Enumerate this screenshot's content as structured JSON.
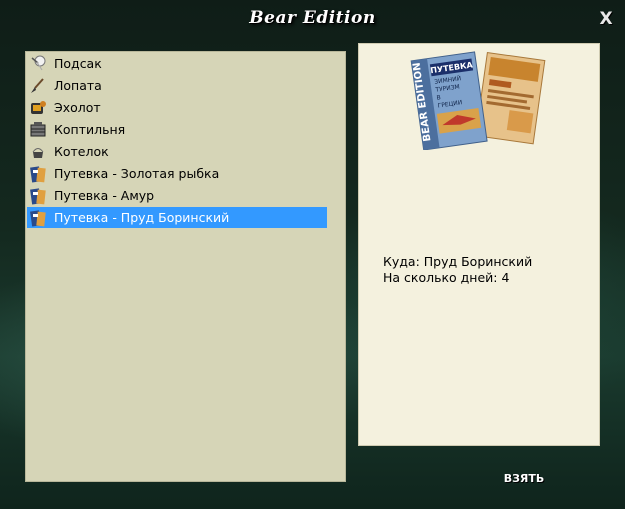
{
  "window": {
    "title": "Bear Edition",
    "close_label": "X"
  },
  "items": [
    {
      "label": "Подсак",
      "icon": "landing-net-icon"
    },
    {
      "label": "Лопата",
      "icon": "shovel-icon"
    },
    {
      "label": "Эхолот",
      "icon": "echo-sounder-icon"
    },
    {
      "label": "Коптильня",
      "icon": "smokehouse-icon"
    },
    {
      "label": "Котелок",
      "icon": "kettle-icon"
    },
    {
      "label": "Путевка - Золотая рыбка",
      "icon": "voucher-icon"
    },
    {
      "label": "Путевка - Амур",
      "icon": "voucher-icon"
    },
    {
      "label": "Путевка - Пруд Боринский",
      "icon": "voucher-icon",
      "selected": true
    }
  ],
  "detail": {
    "image": "travel-brochure",
    "brochure_text": [
      "BEAR EDITION",
      "ПУТЕВКА",
      "ЗИМНИЙ",
      "ТУРИЗМ",
      "В",
      "ГРЕЦИИ"
    ],
    "destination_line": "Куда: Пруд Боринский",
    "days_line": "На сколько дней: 4"
  },
  "actions": {
    "take_label": "ВЗЯТЬ"
  },
  "colors": {
    "list_bg": "#d6d5b7",
    "detail_bg": "#f4f1de",
    "selection": "#3399ff",
    "background": "#14291f"
  }
}
